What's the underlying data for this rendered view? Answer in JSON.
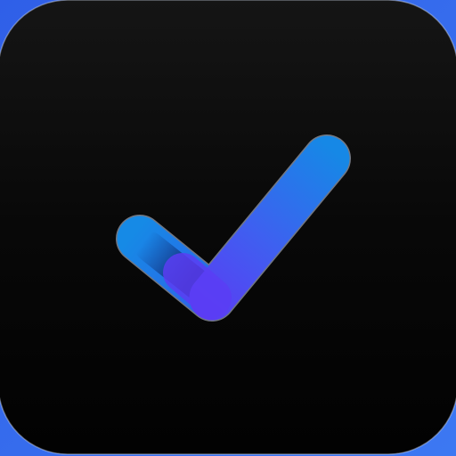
{
  "app_icon": {
    "icon": "checkmark-icon",
    "colors": {
      "background_edge": "#3a6df0",
      "tile_top": "#141414",
      "tile_bottom": "#020202",
      "check_light": "#1689e6",
      "check_dark": "#5b3cf4",
      "check_shadow": "#0b1f59"
    }
  }
}
